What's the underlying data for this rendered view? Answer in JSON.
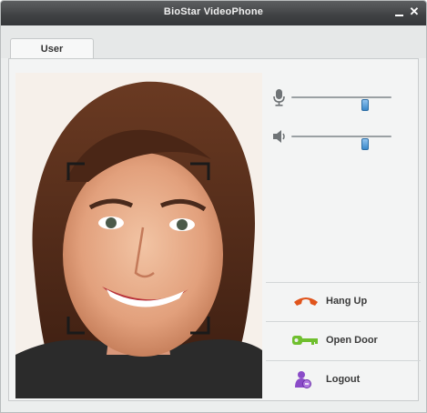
{
  "window": {
    "title": "BioStar VideoPhone"
  },
  "tabs": [
    {
      "label": "User"
    }
  ],
  "controls": {
    "mic_level": 0.74,
    "speaker_level": 0.74
  },
  "actions": {
    "hang_up": "Hang Up",
    "open_door": "Open Door",
    "logout": "Logout"
  },
  "icons": {
    "minimize": "minimize-icon",
    "close": "close-icon",
    "microphone": "microphone-icon",
    "speaker": "speaker-icon",
    "hang_up": "phone-hangup-icon",
    "open_door": "key-icon",
    "logout": "logout-user-icon"
  },
  "colors": {
    "titlebar": "#3f4143",
    "slider_thumb": "#3a88c9",
    "hangup_icon": "#e0541c",
    "key_icon": "#6fbf2e",
    "logout_icon": "#8a4bc8"
  }
}
